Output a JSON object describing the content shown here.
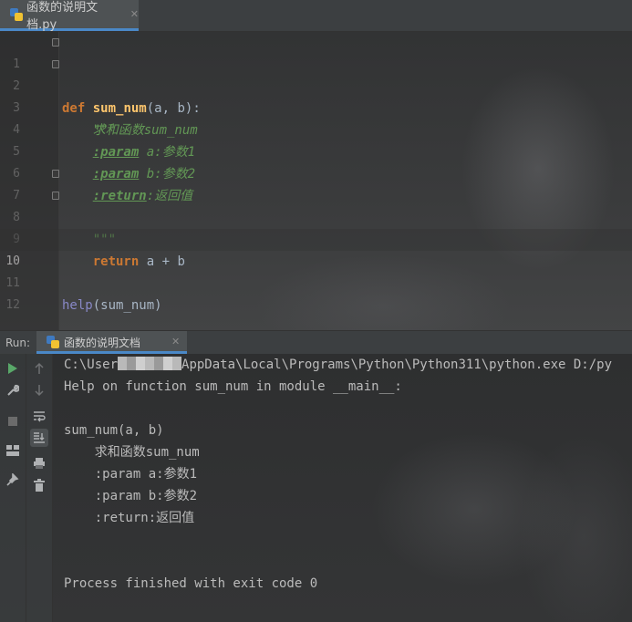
{
  "editor": {
    "tab": {
      "filename": "函数的说明文档.py",
      "close_glyph": "✕"
    },
    "lines": [
      {
        "num": "1",
        "code": "def sum_num(a, b):"
      },
      {
        "num": "2",
        "code": "    \"\"\""
      },
      {
        "num": "3",
        "code": "    求和函数sum_num"
      },
      {
        "num": "4",
        "code": "    :param a:参数1"
      },
      {
        "num": "5",
        "code": "    :param b:参数2"
      },
      {
        "num": "6",
        "code": "    :return:返回值"
      },
      {
        "num": "7",
        "code": "    \"\"\""
      },
      {
        "num": "8",
        "code": "    return a + b"
      },
      {
        "num": "9",
        "code": ""
      },
      {
        "num": "10",
        "code": ""
      },
      {
        "num": "11",
        "code": "help(sum_num)"
      },
      {
        "num": "12",
        "code": ""
      }
    ],
    "tokens": {
      "l1_def": "def",
      "l1_fn": "sum_num",
      "l1_rest": "(a, b):",
      "l2_doc": "\"\"\"",
      "l3_doc": "求和函数sum_num",
      "l4_tag": ":param",
      "l4_rest": " a:参数1",
      "l5_tag": ":param",
      "l5_rest": " b:参数2",
      "l6_tag": ":return",
      "l6_rest": ":返回值",
      "l7_doc": "\"\"\"",
      "l8_kw": "return",
      "l8_rest": " a + b",
      "l11_bi": "help",
      "l11_rest": "(sum_num)"
    }
  },
  "run": {
    "label": "Run:",
    "tab": {
      "name": "函数的说明文档",
      "close_glyph": "✕"
    },
    "output": {
      "path_prefix": "C:\\User",
      "path_suffix": "AppData\\Local\\Programs\\Python\\Python311\\python.exe D:/py",
      "lines": [
        "Help on function sum_num in module __main__:",
        "",
        "sum_num(a, b)",
        "    求和函数sum_num",
        "    :param a:参数1",
        "    :param b:参数2",
        "    :return:返回值",
        "",
        "",
        "Process finished with exit code 0"
      ]
    }
  },
  "colors": {
    "keyword": "#cc7832",
    "function": "#ffc66d",
    "docstring": "#629755",
    "builtin": "#8888c6",
    "text": "#a9b7c6",
    "accent": "#4a88c7",
    "run_green": "#59a869"
  }
}
